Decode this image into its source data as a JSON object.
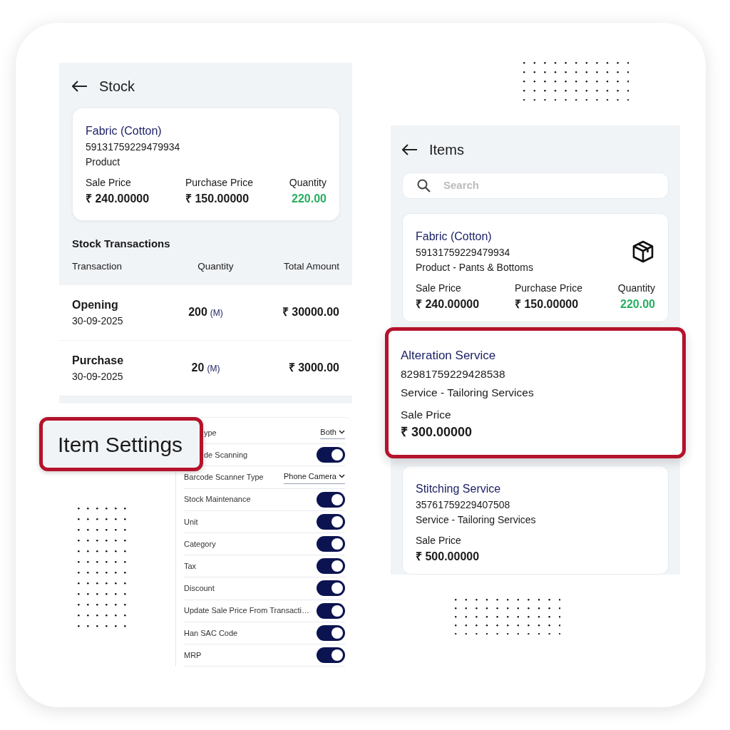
{
  "stock": {
    "title": "Stock",
    "item": {
      "name": "Fabric (Cotton)",
      "code": "59131759229479934",
      "category": "Product",
      "fields": [
        {
          "kind": "price",
          "label": "Sale Price",
          "value": "₹ 240.00000"
        },
        {
          "kind": "price",
          "label": "Purchase Price",
          "value": "₹ 150.00000"
        },
        {
          "kind": "quantity",
          "label": "Quantity",
          "value": "220.00"
        }
      ]
    },
    "section_title": "Stock Transactions",
    "columns": [
      "Transaction",
      "Quantity",
      "Total Amount"
    ],
    "rows": [
      {
        "transaction": "Opening",
        "date": "30-09-2025",
        "quantity": "200",
        "unit": "(M)",
        "amount": "₹ 30000.00"
      },
      {
        "transaction": "Purchase",
        "date": "30-09-2025",
        "quantity": "20",
        "unit": "(M)",
        "amount": "₹ 3000.00"
      }
    ]
  },
  "settings": {
    "callout": "Item Settings",
    "rows": [
      {
        "kind": "select",
        "label": "ype",
        "value": "Both"
      },
      {
        "kind": "toggle",
        "label": "de Scanning",
        "on": true
      },
      {
        "kind": "select",
        "label": "Barcode Scanner Type",
        "value": "Phone Camera"
      },
      {
        "kind": "toggle",
        "label": "Stock Maintenance",
        "on": true
      },
      {
        "kind": "toggle",
        "label": "Unit",
        "on": true
      },
      {
        "kind": "toggle",
        "label": "Category",
        "on": true
      },
      {
        "kind": "toggle",
        "label": "Tax",
        "on": true
      },
      {
        "kind": "toggle",
        "label": "Discount",
        "on": true
      },
      {
        "kind": "toggle",
        "label": "Update Sale Price From Transacti…",
        "on": true
      },
      {
        "kind": "toggle",
        "label": "Han SAC Code",
        "on": true
      },
      {
        "kind": "toggle",
        "label": "MRP",
        "on": true
      }
    ]
  },
  "items": {
    "title": "Items",
    "search": {
      "placeholder": "Search"
    },
    "cards": [
      {
        "kind": "product",
        "highlighted": false,
        "name": "Fabric (Cotton)",
        "code": "59131759229479934",
        "category": "Product - Pants & Bottoms",
        "fields": [
          {
            "kind": "price",
            "label": "Sale Price",
            "value": "₹ 240.00000"
          },
          {
            "kind": "price",
            "label": "Purchase Price",
            "value": "₹ 150.00000"
          },
          {
            "kind": "quantity",
            "label": "Quantity",
            "value": "220.00"
          }
        ]
      },
      {
        "kind": "service",
        "highlighted": true,
        "name": "Alteration Service",
        "code": "82981759229428538",
        "category": "Service - Tailoring Services",
        "fields": [
          {
            "kind": "price",
            "label": "Sale Price",
            "value": "₹ 300.00000"
          }
        ]
      },
      {
        "kind": "service",
        "highlighted": false,
        "name": "Stitching Service",
        "code": "35761759229407508",
        "category": "Service - Tailoring Services",
        "fields": [
          {
            "kind": "price",
            "label": "Sale Price",
            "value": "₹ 500.00000"
          }
        ]
      }
    ]
  }
}
